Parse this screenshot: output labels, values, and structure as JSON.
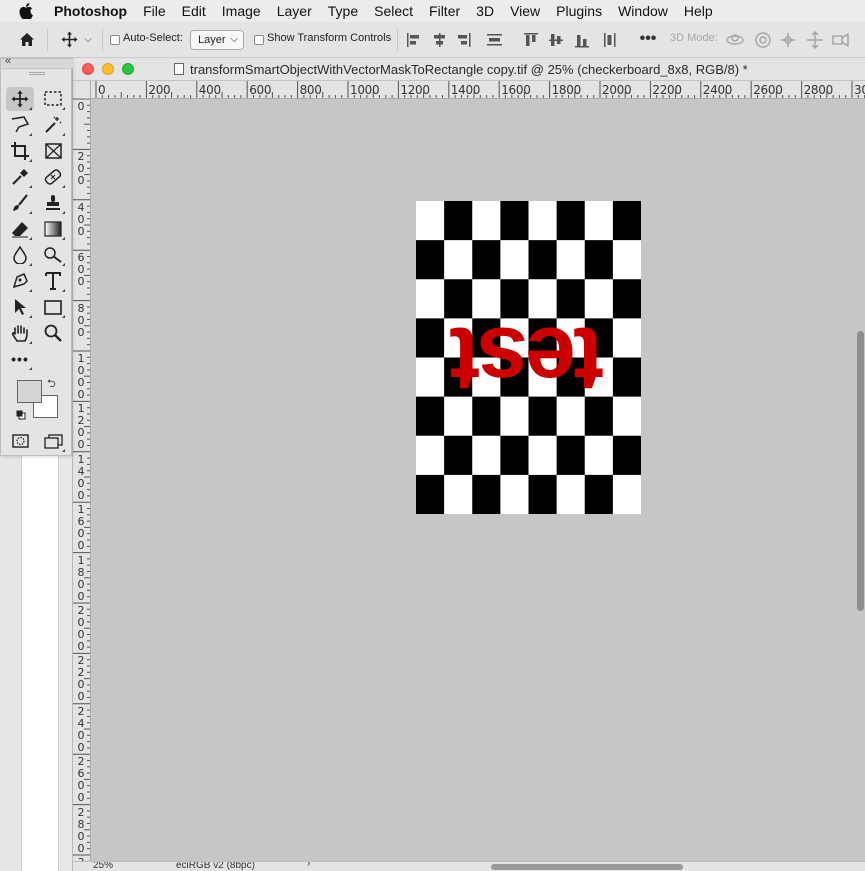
{
  "menubar": {
    "app_name": "Photoshop",
    "items": [
      "File",
      "Edit",
      "Image",
      "Layer",
      "Type",
      "Select",
      "Filter",
      "3D",
      "View",
      "Plugins",
      "Window",
      "Help"
    ]
  },
  "options_bar": {
    "auto_select_label": "Auto-Select:",
    "auto_select_checked": false,
    "auto_select_target": "Layer",
    "show_transform_label": "Show Transform Controls",
    "show_transform_checked": false,
    "mode_3d_label": "3D Mode:"
  },
  "document": {
    "title": "transformSmartObjectWithVectorMaskToRectangle copy.tif @ 25% (checkerboard_8x8, RGB/8) *",
    "zoom": "25%",
    "color_profile": "eciRGB v2 (8bpc)",
    "ruler_h_labels": [
      "0",
      "200",
      "400",
      "600",
      "800",
      "1000",
      "1200",
      "1400",
      "1600",
      "1800",
      "2000",
      "2200",
      "2400",
      "2600",
      "2800",
      "30"
    ],
    "ruler_v_labels": [
      "0",
      "200",
      "400",
      "600",
      "800",
      "1000",
      "1200",
      "1400",
      "1600",
      "1800",
      "2000",
      "2200",
      "2400",
      "2600",
      "2800",
      "3"
    ],
    "canvas_text": "test",
    "canvas_text_color": "#cc0000",
    "checker_dark": "#000000",
    "checker_light": "#ffffff",
    "pasteboard_color": "#c6c6c6"
  },
  "tools": {
    "foreground_color": "#d4d4d4",
    "background_color": "#ffffff",
    "active_tool": "move-tool"
  }
}
